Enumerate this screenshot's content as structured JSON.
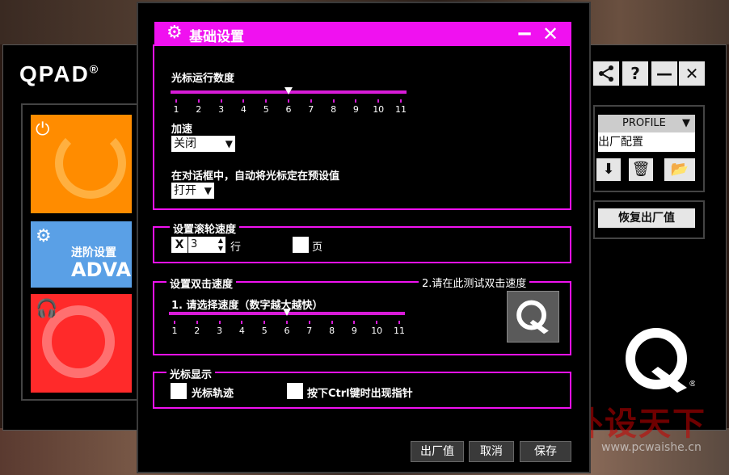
{
  "app": {
    "logo_text": "QPAD",
    "logo_mark": "®"
  },
  "tiles": [
    {
      "name": "power",
      "icon": "power-icon",
      "color": "#ff8c00"
    },
    {
      "name": "advanced",
      "icon": "gear-icon",
      "color": "#5aa0e6",
      "label_cn": "进阶设置",
      "label_en": "ADVA"
    },
    {
      "name": "support",
      "icon": "headset-icon",
      "color": "#ff2a2a"
    }
  ],
  "right_panel": {
    "profile_label": "PROFILE",
    "profile_value": "出厂配置",
    "restore_label": "恢复出厂值"
  },
  "watermark": {
    "text": "外设天下",
    "url": "www.pcwaishe.cn"
  },
  "dialog": {
    "title": "基础设置",
    "accent": "#f011f0",
    "pointer_speed": {
      "label": "光标运行数度",
      "ticks": [
        "1",
        "2",
        "3",
        "4",
        "5",
        "6",
        "7",
        "8",
        "9",
        "10",
        "11"
      ],
      "value": 6
    },
    "acceleration": {
      "label": "加速",
      "value": "关闭"
    },
    "snap_to": {
      "label": "在对话框中，自动将光标定在预设值",
      "value": "打开"
    },
    "scroll": {
      "legend": "设置滚轮速度",
      "lines_mark": "X",
      "lines_value": "3",
      "lines_unit": "行",
      "page_unit": "页"
    },
    "double_click": {
      "legend": "设置双击速度",
      "test_legend": "2.请在此测试双击速度",
      "slider_label": "1. 请选择速度（数字越大越快）",
      "ticks": [
        "1",
        "2",
        "3",
        "4",
        "5",
        "6",
        "7",
        "8",
        "9",
        "10",
        "11"
      ],
      "value": 6
    },
    "pointer_display": {
      "legend": "光标显示",
      "trail_label": "光标轨迹",
      "ctrl_label": "按下Ctrl键时出现指针"
    },
    "buttons": {
      "factory": "出厂值",
      "cancel": "取消",
      "save": "保存"
    }
  }
}
